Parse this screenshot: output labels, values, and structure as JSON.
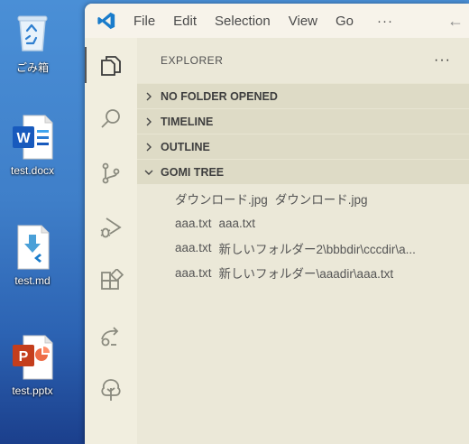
{
  "desktop": {
    "icons": [
      {
        "label": "ごみ箱",
        "icon": "recycle-bin-icon"
      },
      {
        "label": "test.docx",
        "icon": "word-document-icon"
      },
      {
        "label": "test.md",
        "icon": "markdown-file-icon"
      },
      {
        "label": "test.pptx",
        "icon": "powerpoint-file-icon"
      }
    ]
  },
  "window": {
    "menu": [
      "File",
      "Edit",
      "Selection",
      "View",
      "Go"
    ],
    "menu_more": "···",
    "back_icon": "←",
    "sidebar": {
      "title": "EXPLORER",
      "more": "···",
      "sections": [
        {
          "label": "NO FOLDER OPENED",
          "expanded": false
        },
        {
          "label": "TIMELINE",
          "expanded": false
        },
        {
          "label": "OUTLINE",
          "expanded": false
        },
        {
          "label": "GOMI TREE",
          "expanded": true
        }
      ],
      "tree_items": [
        {
          "name": "ダウンロード.jpg",
          "desc": "ダウンロード.jpg"
        },
        {
          "name": "aaa.txt",
          "desc": "aaa.txt"
        },
        {
          "name": "aaa.txt",
          "desc": "新しいフォルダー2\\bbbdir\\cccdir\\a..."
        },
        {
          "name": "aaa.txt",
          "desc": "新しいフォルダー\\aaadir\\aaa.txt"
        }
      ]
    }
  },
  "colors": {
    "window_bg": "#ece9d9",
    "section_bg": "#dedbc6",
    "vscode_blue": "#1a7ccb"
  }
}
